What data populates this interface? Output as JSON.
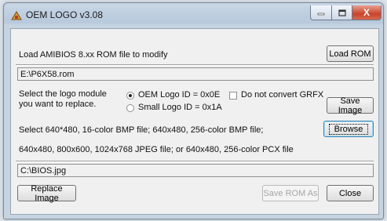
{
  "window": {
    "title": "OEM LOGO v3.08"
  },
  "titlebar": {
    "minimize": "–",
    "maximize": "□",
    "close": "X"
  },
  "rom": {
    "instruction": "Load AMIBIOS 8.xx ROM file to modify",
    "load_button": "Load ROM",
    "path": "E:\\P6X58.rom"
  },
  "module": {
    "label_line1": "Select the logo module",
    "label_line2": "you want to replace.",
    "oem_option": "OEM Logo  ID = 0x0E",
    "small_option": "Small Logo  ID = 0x1A",
    "selected": "oem",
    "no_convert_label": "Do not convert GRFX",
    "no_convert_checked": false,
    "save_image_button": "Save Image"
  },
  "image": {
    "formats_line1": "Select 640*480, 16-color BMP file;  640x480, 256-color BMP file;",
    "formats_line2": "640x480, 800x600, 1024x768 JPEG file;  or  640x480, 256-color PCX file",
    "browse_button": "Browse",
    "path": "C:\\BIOS.jpg"
  },
  "actions": {
    "replace_button": "Replace Image",
    "save_rom_button": "Save ROM As",
    "close_button": "Close"
  }
}
